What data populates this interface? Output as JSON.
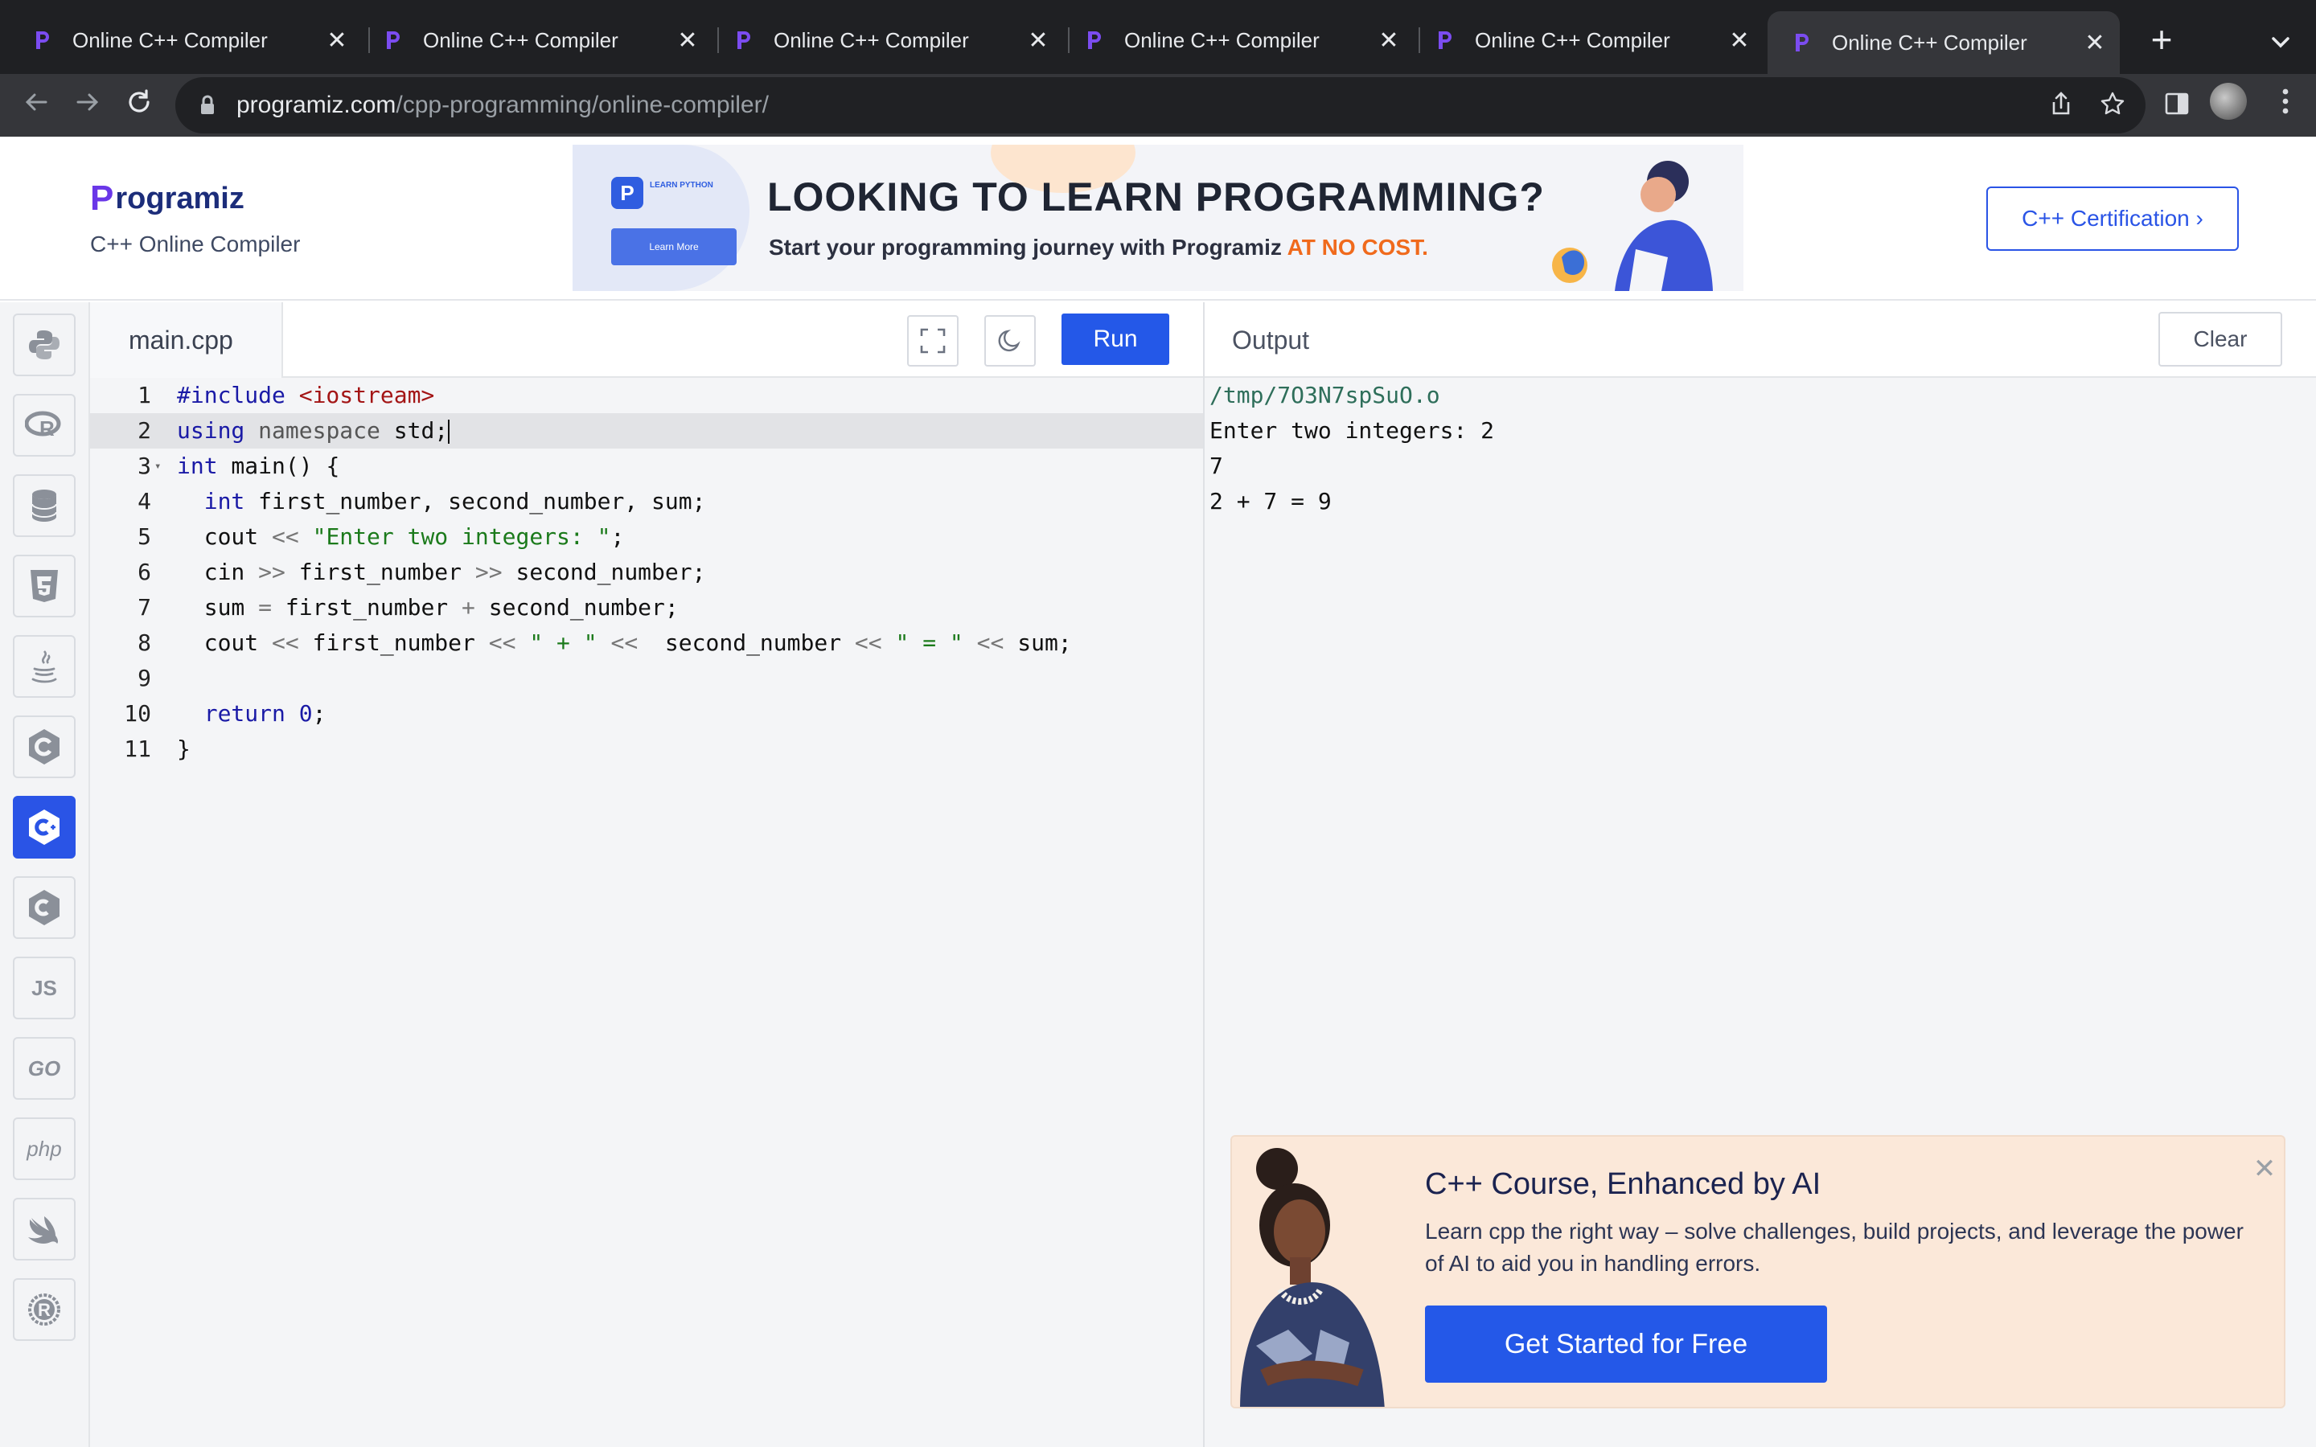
{
  "browser": {
    "tabs": [
      {
        "title": "Online C++ Compiler",
        "active": false
      },
      {
        "title": "Online C++ Compiler",
        "active": false
      },
      {
        "title": "Online C++ Compiler",
        "active": false
      },
      {
        "title": "Online C++ Compiler",
        "active": false
      },
      {
        "title": "Online C++ Compiler",
        "active": false
      },
      {
        "title": "Online C++ Compiler",
        "active": true
      }
    ],
    "close_glyph": "✕",
    "new_tab_glyph": "+",
    "url_domain": "programiz.com",
    "url_path": "/cpp-programming/online-compiler/"
  },
  "header": {
    "brand_mark": "P",
    "brand_rest": "rogramiz",
    "subtitle": "C++ Online Compiler",
    "certification_label": "C++ Certification ›"
  },
  "banner": {
    "mini_logo": "P",
    "mini_text": "LEARN PYTHON",
    "learn_more": "Learn More",
    "headline": "LOOKING TO LEARN PROGRAMMING?",
    "subline": "Start your programming journey with Programiz ",
    "subline_highlight": "AT NO COST."
  },
  "rail": {
    "items": [
      {
        "name": "python",
        "label": ""
      },
      {
        "name": "r",
        "label": "R"
      },
      {
        "name": "sql",
        "label": ""
      },
      {
        "name": "html",
        "label": "5"
      },
      {
        "name": "java",
        "label": ""
      },
      {
        "name": "c",
        "label": "C"
      },
      {
        "name": "cpp",
        "label": "C+",
        "active": true
      },
      {
        "name": "csharp",
        "label": "C#"
      },
      {
        "name": "javascript",
        "label": "JS"
      },
      {
        "name": "go",
        "label": "GO"
      },
      {
        "name": "php",
        "label": "php"
      },
      {
        "name": "swift",
        "label": ""
      },
      {
        "name": "rust",
        "label": "R"
      }
    ]
  },
  "editor": {
    "file_name": "main.cpp",
    "run_label": "Run",
    "fullscreen_icon": "fullscreen-icon",
    "theme_icon": "moon-icon",
    "line_numbers": [
      "1",
      "2",
      "3",
      "4",
      "5",
      "6",
      "7",
      "8",
      "9",
      "10",
      "11"
    ]
  },
  "output": {
    "title": "Output",
    "clear_label": "Clear",
    "lines": [
      "/tmp/7O3N7spSuO.o",
      "Enter two integers: 2",
      "7",
      "2 + 7 = 9"
    ]
  },
  "promo": {
    "title": "C++ Course, Enhanced by AI",
    "description": "Learn cpp the right way – solve challenges, build projects, and leverage the power of AI to aid you in handling errors.",
    "cta": "Get Started for Free",
    "close_glyph": "✕"
  },
  "colors": {
    "accent": "#2458e8",
    "brand_purple": "#6a37e8",
    "promo_bg": "#fbe8d9",
    "chrome_dark": "#35363a"
  }
}
